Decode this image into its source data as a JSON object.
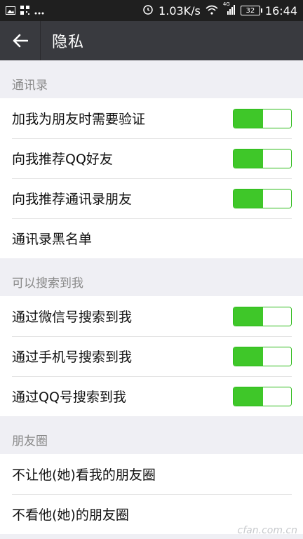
{
  "status_bar": {
    "speed": "1.03K/s",
    "signal": "4G",
    "battery": "32",
    "time": "16:44"
  },
  "app_bar": {
    "title": "隐私"
  },
  "sections": [
    {
      "header": "通讯录",
      "items": [
        {
          "label": "加我为朋友时需要验证",
          "toggle": true,
          "on": true
        },
        {
          "label": "向我推荐QQ好友",
          "toggle": true,
          "on": true
        },
        {
          "label": "向我推荐通讯录朋友",
          "toggle": true,
          "on": true
        },
        {
          "label": "通讯录黑名单",
          "toggle": false
        }
      ]
    },
    {
      "header": "可以搜索到我",
      "items": [
        {
          "label": "通过微信号搜索到我",
          "toggle": true,
          "on": true
        },
        {
          "label": "通过手机号搜索到我",
          "toggle": true,
          "on": true
        },
        {
          "label": "通过QQ号搜索到我",
          "toggle": true,
          "on": true
        }
      ]
    },
    {
      "header": "朋友圈",
      "items": [
        {
          "label": "不让他(她)看我的朋友圈",
          "toggle": false
        },
        {
          "label": "不看他(她)的朋友圈",
          "toggle": false
        }
      ]
    }
  ],
  "watermark": "cfan.com.cn",
  "colors": {
    "toggle_on": "#3fc729",
    "app_bar": "#393a3f",
    "status_bar": "#1f1f1f"
  }
}
